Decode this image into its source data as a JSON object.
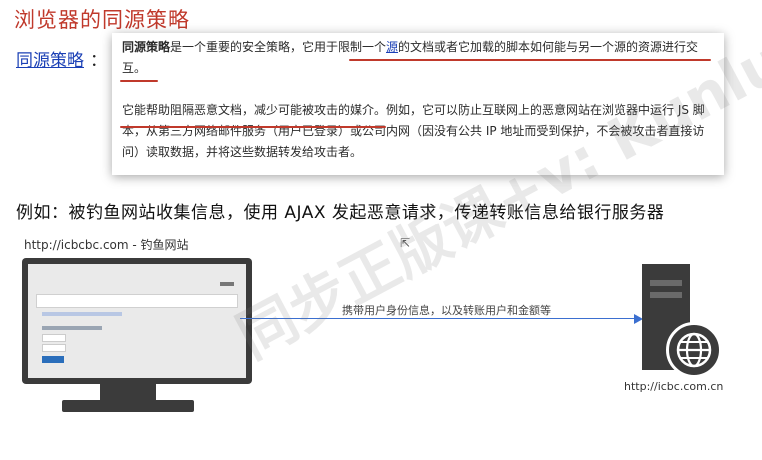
{
  "slide": {
    "title": "浏览器的同源策略",
    "sop_link": "同源策略",
    "sop_colon": "：",
    "definition": {
      "term": "同源策略",
      "text_a": "是一个重要的安全策略，它用于限制一个",
      "link_word": "源",
      "text_b": "的文档或者它加载的脚本如何能与另一个源的资源进行交互。",
      "p2": "它能帮助阻隔恶意文档，减少可能被攻击的媒介。例如，它可以防止互联网上的恶意网站在浏览器中运行 JS 脚本，从第三方网络邮件服务（用户已登录）或公司内网（因没有公共 IP 地址而受到保护，不会被攻击者直接访问）读取数据，并将这些数据转发给攻击者。"
    },
    "example": "例如：被钓鱼网站收集信息，使用 AJAX 发起恶意请求，传递转账信息给银行服务器",
    "phishing_caption": "http://icbcbc.com - 钓鱼网站",
    "arrow_label": "携带用户身份信息，以及转账用户和金额等",
    "server_caption": "http://icbc.com.cn",
    "watermark": "同步正版课+v: Kunlun"
  },
  "colors": {
    "title": "#c0392b",
    "link": "#1a3fb5",
    "underline": "#c0392b",
    "arrow": "#3b6fd0",
    "device": "#3b3b3b"
  },
  "icons": [
    "desktop-monitor-icon",
    "server-icon",
    "globe-icon",
    "cursor-icon"
  ]
}
